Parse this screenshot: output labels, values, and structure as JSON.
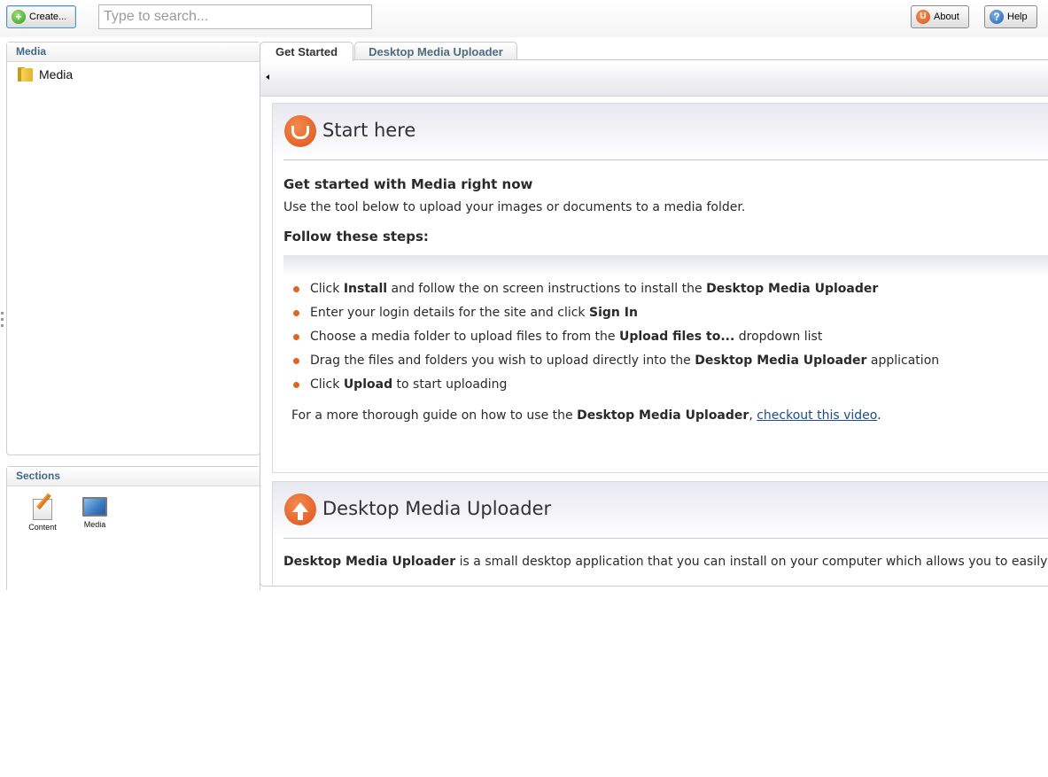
{
  "topbar": {
    "create_label": "Create...",
    "search_placeholder": "Type to search...",
    "about_label": "About",
    "help_label": "Help"
  },
  "media_panel": {
    "title": "Media",
    "tree": [
      {
        "label": "Media",
        "icon": "folder-icon"
      }
    ]
  },
  "sections_panel": {
    "title": "Sections",
    "items": [
      {
        "label": "Content",
        "icon": "content-icon"
      },
      {
        "label": "Media",
        "icon": "media-icon"
      }
    ]
  },
  "tabs": [
    {
      "label": "Get Started",
      "active": true
    },
    {
      "label": "Desktop Media Uploader",
      "active": false
    }
  ],
  "start_here": {
    "title": "Start here",
    "subtitle": "Get started with Media right now",
    "intro": "Use the tool below to upload your images or documents to a media folder.",
    "steps_heading": "Follow these steps:",
    "steps": [
      {
        "t1": "Click ",
        "b1": "Install",
        "t2": " and follow the on screen instructions to install the ",
        "b2": "Desktop Media Uploader",
        "t3": ""
      },
      {
        "t1": "Enter your login details for the site and click ",
        "b1": "Sign In",
        "t2": "",
        "b2": "",
        "t3": ""
      },
      {
        "t1": "Choose a media folder to upload files to from the ",
        "b1": "Upload files to...",
        "t2": " dropdown list",
        "b2": "",
        "t3": ""
      },
      {
        "t1": "Drag the files and folders you wish to upload directly into the ",
        "b1": "Desktop Media Uploader",
        "t2": " application",
        "b2": "",
        "t3": ""
      },
      {
        "t1": "Click ",
        "b1": "Upload",
        "t2": " to start uploading",
        "b2": "",
        "t3": ""
      }
    ],
    "guide_text_1": "For a more thorough guide on how to use the ",
    "guide_bold": "Desktop Media Uploader",
    "guide_text_2": ", ",
    "guide_link": "checkout this video",
    "guide_end": "."
  },
  "uploader_section": {
    "title": "Desktop Media Uploader",
    "desc_bold": "Desktop Media Uploader",
    "desc_text": " is a small desktop application that you can install on your computer which allows you to easily u"
  },
  "colors": {
    "accent_orange": "#dc5419",
    "panel_title": "#3e6a85",
    "link": "#1a4d8c"
  }
}
